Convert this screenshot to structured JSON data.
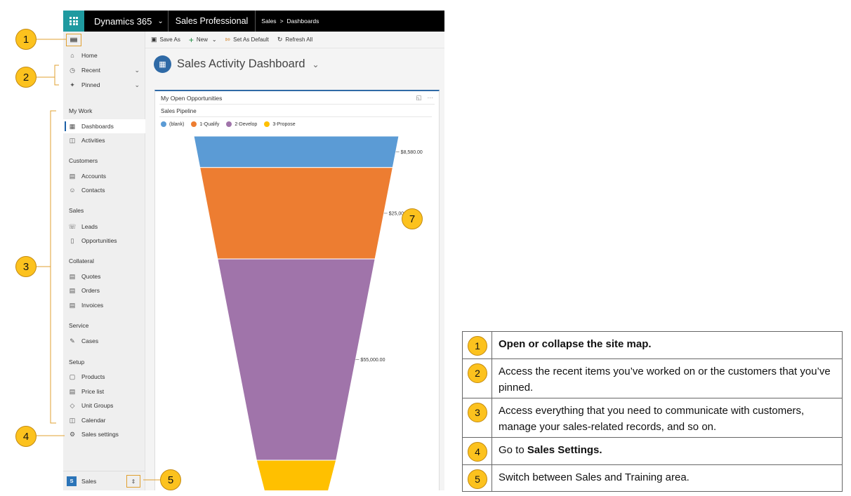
{
  "topbar": {
    "brand": "Dynamics 365",
    "app_name": "Sales Professional",
    "breadcrumb_area": "Sales",
    "breadcrumb_sep": ">",
    "breadcrumb_page": "Dashboards"
  },
  "sidebar": {
    "top_items": [
      {
        "label": "Home",
        "icon": "home-icon"
      },
      {
        "label": "Recent",
        "icon": "clock-icon"
      },
      {
        "label": "Pinned",
        "icon": "pin-icon"
      }
    ],
    "sections": {
      "my_work": "My Work",
      "customers": "Customers",
      "sales": "Sales",
      "collateral": "Collateral",
      "service": "Service",
      "setup": "Setup"
    },
    "items": {
      "dashboards": "Dashboards",
      "activities": "Activities",
      "accounts": "Accounts",
      "contacts": "Contacts",
      "leads": "Leads",
      "opportunities": "Opportunities",
      "quotes": "Quotes",
      "orders": "Orders",
      "invoices": "Invoices",
      "cases": "Cases",
      "products": "Products",
      "price_list": "Price list",
      "unit_groups": "Unit Groups",
      "calendar": "Calendar",
      "sales_settings": "Sales settings"
    },
    "area_badge": "S",
    "area_label": "Sales"
  },
  "command_bar": {
    "save_as": "Save As",
    "new": "New",
    "set_as_default": "Set As Default",
    "refresh_all": "Refresh All"
  },
  "dashboard": {
    "title": "Sales Activity Dashboard",
    "card_title": "My Open Opportunities"
  },
  "chart_data": {
    "type": "funnel",
    "title": "Sales Pipeline",
    "categories": [
      "(blank)",
      "1-Qualify",
      "2-Develop",
      "3-Propose"
    ],
    "values": [
      8580,
      25000,
      55000,
      null
    ],
    "labels": [
      "$8,580.00",
      "$25,000.00",
      "$55,000.00",
      ""
    ],
    "colors": [
      "#5b9bd5",
      "#ed7d31",
      "#a074aa",
      "#ffc000"
    ],
    "legend_position": "top-left"
  },
  "callouts": [
    "1",
    "2",
    "3",
    "4",
    "5",
    "7"
  ],
  "legend_table": [
    {
      "num": "1",
      "bold": "Open or collapse the site map.",
      "pre": "",
      "post": ""
    },
    {
      "num": "2",
      "bold": "",
      "pre": "Access the recent items you’ve worked on or the customers that you’ve pinned.",
      "post": ""
    },
    {
      "num": "3",
      "bold": "",
      "pre": "Access everything that you need to communicate with customers, manage your sales-related records, and so on.",
      "post": ""
    },
    {
      "num": "4",
      "bold": "Sales Settings.",
      "pre": "Go to ",
      "post": ""
    },
    {
      "num": "5",
      "bold": "",
      "pre": "Switch between Sales and Training area.",
      "post": ""
    }
  ]
}
